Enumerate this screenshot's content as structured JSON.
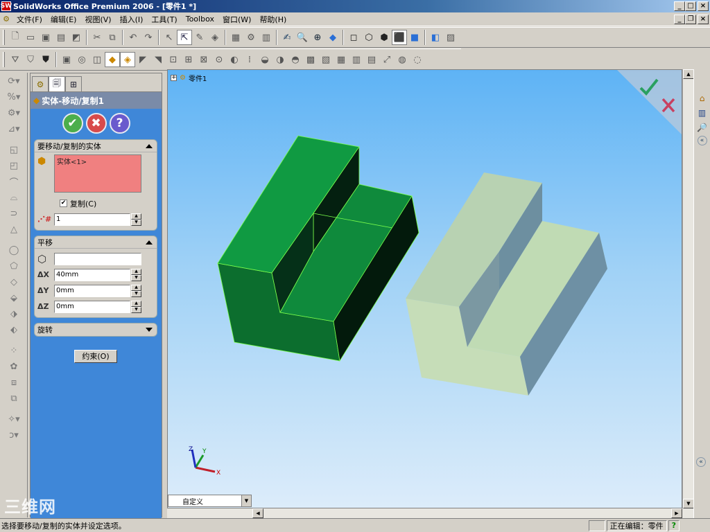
{
  "window": {
    "title": "SolidWorks Office Premium 2006 - [零件1 *]",
    "logo_text": "SW",
    "controls": {
      "minimize": "_",
      "maximize": "□",
      "close": "×",
      "restore": "❐"
    }
  },
  "menu": [
    "文件(F)",
    "编辑(E)",
    "视图(V)",
    "插入(I)",
    "工具(T)",
    "Toolbox",
    "窗口(W)",
    "帮助(H)"
  ],
  "feature_manager": {
    "tabs": [
      "feature-tree",
      "property-manager",
      "configuration-manager"
    ],
    "title": "实体-移动/复制1",
    "buttons": {
      "ok": "✔",
      "cancel": "✖",
      "help": "?"
    },
    "bodies_group": {
      "label": "要移动/复制的实体",
      "selection": "实体<1>",
      "copy_label": "复制(C)",
      "copy_checked": true,
      "copies_value": "1"
    },
    "translate_group": {
      "label": "平移",
      "reference_value": "",
      "dx_label": "ΔX",
      "dx": "40mm",
      "dy_label": "ΔY",
      "dy": "0mm",
      "dz_label": "ΔZ",
      "dz": "0mm"
    },
    "rotate_group": {
      "label": "旋转"
    },
    "constraint_button": "约束(O)"
  },
  "viewport": {
    "tree_label": "零件1",
    "view_orientation": "自定义",
    "triad": {
      "x": "X",
      "y": "Y",
      "z": "Z"
    },
    "colors": {
      "selected_body": "#0e8a3e",
      "copy_body": "#c6ddb8",
      "confirm_ok": "#2aa060",
      "confirm_cancel": "#c84060"
    }
  },
  "status": {
    "message": "选择要移动/复制的实体并设定选项。",
    "mode": "正在编辑：零件",
    "help": "?"
  },
  "watermark": "三维网"
}
